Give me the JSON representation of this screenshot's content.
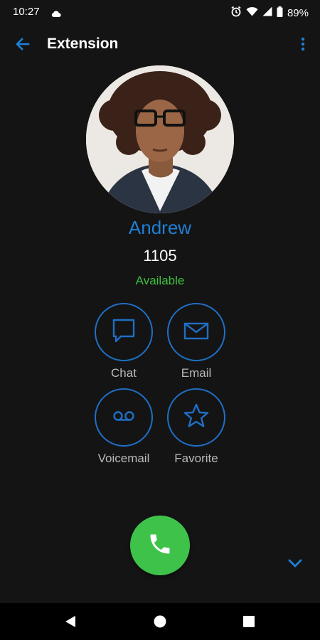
{
  "status_bar": {
    "time": "10:27",
    "battery": "89%",
    "icons": [
      "cloud-icon",
      "alarm-icon",
      "wifi-icon",
      "signal-icon",
      "battery-icon"
    ]
  },
  "app_bar": {
    "title": "Extension",
    "back_icon": "arrow-left-icon",
    "menu_icon": "more-vert-icon"
  },
  "contact": {
    "name": "Andrew",
    "extension": "1105",
    "status": "Available"
  },
  "actions": [
    {
      "label": "Chat",
      "icon": "chat-icon"
    },
    {
      "label": "Email",
      "icon": "email-icon"
    },
    {
      "label": "Voicemail",
      "icon": "voicemail-icon"
    },
    {
      "label": "Favorite",
      "icon": "star-icon"
    }
  ],
  "call": {
    "icon": "phone-icon"
  },
  "nav": {
    "icons": [
      "back-triangle-icon",
      "home-circle-icon",
      "recents-square-icon"
    ]
  },
  "colors": {
    "background": "#141414",
    "accent_blue": "#1f7fd6",
    "available_green": "#3fbf3f",
    "call_green": "#3ec24a",
    "label_gray": "#b9b9b9"
  }
}
